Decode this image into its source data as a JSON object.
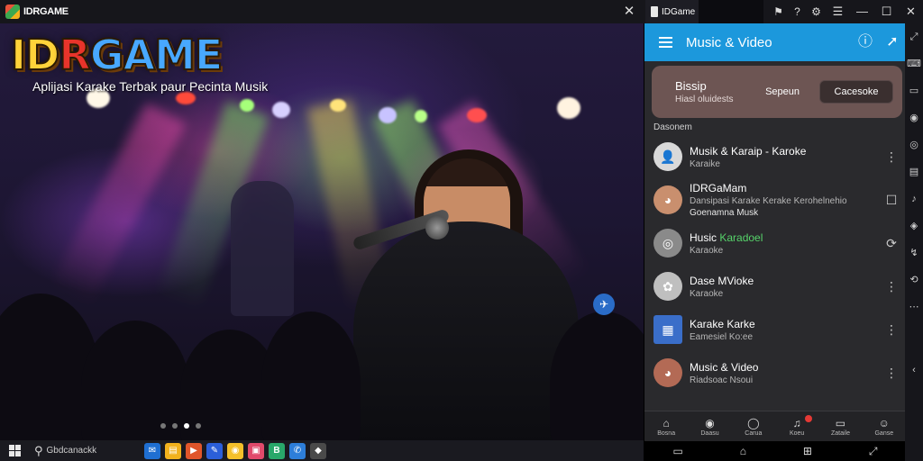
{
  "emulator": {
    "app_name": "IDRGAME",
    "tab_label": "IDGame",
    "toolbar_icons": [
      "feedback-icon",
      "help-icon",
      "settings-icon"
    ],
    "window_controls": [
      "menu",
      "minimize",
      "maximize",
      "close"
    ],
    "side_tools": [
      "expand-icon",
      "keyboard-icon",
      "screen-icon",
      "record-icon",
      "camera-icon",
      "folder-icon",
      "volume-icon",
      "location-icon",
      "shake-icon",
      "rotate-icon",
      "more-icon",
      "back-icon"
    ]
  },
  "banner": {
    "logo": {
      "p1": "I",
      "p2": "D",
      "p3": "R",
      "p4": "GAME"
    },
    "tagline": "Aplijasi Karake Terbak paur Pecinta Musik",
    "carousel": {
      "count": 4,
      "active": 2
    },
    "colors": {
      "logo_yellow": "#ffd33a",
      "logo_red": "#e8342b",
      "logo_blue": "#48a8ff"
    }
  },
  "taskbar": {
    "search_placeholder": "Gbdcanackk",
    "apps": [
      {
        "name": "mail-app",
        "bg": "#1f6fd1",
        "glyph": "✉"
      },
      {
        "name": "files-app",
        "bg": "#f2b21d",
        "glyph": "▤"
      },
      {
        "name": "media-app",
        "bg": "#e0562b",
        "glyph": "▶"
      },
      {
        "name": "feather-app",
        "bg": "#2b5fd9",
        "glyph": "✎"
      },
      {
        "name": "browser-app",
        "bg": "#f4c02a",
        "glyph": "◉"
      },
      {
        "name": "photo-app",
        "bg": "#e14a6b",
        "glyph": "▣"
      },
      {
        "name": "store-app",
        "bg": "#29a86a",
        "glyph": "B"
      },
      {
        "name": "chat-app",
        "bg": "#2d7ed9",
        "glyph": "✆"
      },
      {
        "name": "game-app",
        "bg": "#4a4a4a",
        "glyph": "◆"
      }
    ]
  },
  "phone": {
    "app_title": "Music & Video",
    "hero": {
      "title": "Bissip",
      "subtitle": "Hiasl oluidests",
      "mid_label": "Sepeun",
      "button": "Cacesoke"
    },
    "section_label": "Dasonem",
    "items": [
      {
        "title": "Musik & Karaip - Karoke",
        "accent": "",
        "sub": "Karaike",
        "menu": "⋮",
        "avatar": "person",
        "avatar_bg": "#d9d9d9"
      },
      {
        "title": "IDRGaMam",
        "accent": "",
        "sub": "Dansipasi Karake Kerake Kerohelnehio",
        "sub2": "Goenamna Musk",
        "menu": "☐",
        "avatar": "photo",
        "avatar_bg": "#c98f6e"
      },
      {
        "title": "Husic",
        "accent": "Karadoel",
        "sub": "Karaoke",
        "menu": "⟳",
        "avatar": "disc",
        "avatar_bg": "#8a8a8a"
      },
      {
        "title": "Dase MVioke",
        "accent": "",
        "sub": "Karaoke",
        "menu": "⋮",
        "avatar": "leaf",
        "avatar_bg": "#bfbfbf"
      },
      {
        "title": "Karake Karke",
        "accent": "",
        "sub": "Eamesiel Ko:ee",
        "menu": "⋮",
        "avatar": "grid",
        "avatar_bg": "#3a6ec9"
      },
      {
        "title": "Music & Video",
        "accent": "",
        "sub": "Riadsoac Nsoui",
        "menu": "⋮",
        "avatar": "photo",
        "avatar_bg": "#b36a55"
      }
    ],
    "bottom_nav": [
      {
        "label": "Bosna",
        "icon": "⌂"
      },
      {
        "label": "Daasu",
        "icon": "◉"
      },
      {
        "label": "Carua",
        "icon": "◯"
      },
      {
        "label": "Koeu",
        "icon": "♫"
      },
      {
        "label": "Zataile",
        "icon": "▭"
      },
      {
        "label": "Ganse",
        "icon": "☺"
      }
    ]
  }
}
